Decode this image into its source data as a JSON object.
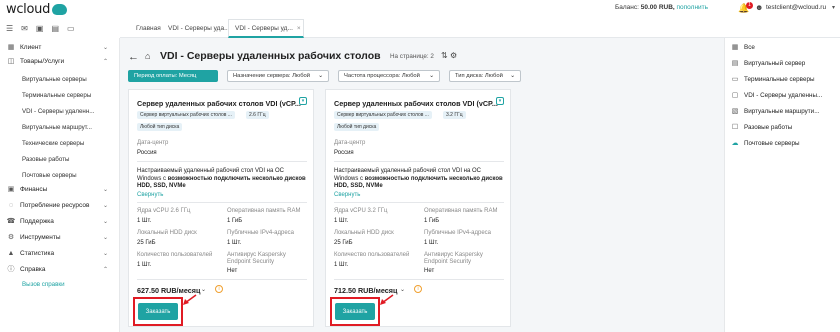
{
  "header": {
    "logo": "wcloud",
    "balance_label": "Баланс:",
    "balance_value": "50.00 RUB,",
    "topup": "пополнить",
    "user": "testclient@wcloud.ru",
    "notif_count": "1"
  },
  "breadcrumbs": [
    "Главная",
    "VDI - Серверы уда...",
    "VDI - Серверы уд..."
  ],
  "sidebar": {
    "items": [
      {
        "label": "Клиент"
      },
      {
        "label": "Товары/Услуги"
      },
      {
        "label": "Финансы"
      },
      {
        "label": "Потребление ресурсов"
      },
      {
        "label": "Поддержка"
      },
      {
        "label": "Инструменты"
      },
      {
        "label": "Статистика"
      },
      {
        "label": "Справка"
      }
    ],
    "products_sub": [
      "Виртуальные серверы",
      "Терминальные серверы",
      "VDI - Серверы удаленн...",
      "Виртуальные маршрут...",
      "Технические серверы",
      "Разовые работы",
      "Почтовые серверы"
    ],
    "help_sub": [
      "Вызов справки"
    ]
  },
  "page": {
    "title": "VDI - Серверы удаленных рабочих столов",
    "per_page": "На странице: 2"
  },
  "filters": [
    "Период оплаты: Месяц",
    "Назначение сервера: Любой",
    "Частота процессора: Любой",
    "Тип диска: Любой"
  ],
  "right_panel": [
    "Все",
    "Виртуальный сервер",
    "Терминальные серверы",
    "VDI - Серверы удаленны...",
    "Виртуальные маршрути...",
    "Разовые работы",
    "Почтовые серверы"
  ],
  "cards": [
    {
      "title": "Сервер удаленных рабочих столов VDI (vCP...",
      "tag1": "Сервер виртуальных рабочих столов ...",
      "tag2": "2.6 ГГц",
      "tag3": "Любой тип диска",
      "dc_label": "Дата-центр",
      "dc_value": "Россия",
      "desc_plain": "Настраиваемый удаленный рабочий стол VDI на ОС Windows с",
      "desc_bold": "возможностью подключить несколько дисков HDD, SSD, NVMe",
      "collapse": "Свернуть",
      "specs": [
        {
          "label": "Ядра vCPU 2.6 ГГц",
          "value": "1 Шт."
        },
        {
          "label": "Оперативная память RAM",
          "value": "1 ГиБ"
        },
        {
          "label": "Локальный HDD диск",
          "value": "25 ГиБ"
        },
        {
          "label": "Публичные IPv4-адреса",
          "value": "1 Шт."
        },
        {
          "label": "Количество пользователей",
          "value": "1 Шт."
        },
        {
          "label": "Антивирус Kaspersky Endpoint Security",
          "value": "Нет"
        }
      ],
      "price": "627.50 RUB/месяц",
      "order": "Заказать"
    },
    {
      "title": "Сервер удаленных рабочих столов VDI (vCP...",
      "tag1": "Сервер виртуальных рабочих столов ...",
      "tag2": "3.2 ГГц",
      "tag3": "Любой тип диска",
      "dc_label": "Дата-центр",
      "dc_value": "Россия",
      "desc_plain": "Настраиваемый удаленный рабочий стол VDI на ОС Windows с",
      "desc_bold": "возможностью подключить несколько дисков HDD, SSD, NVMe",
      "collapse": "Свернуть",
      "specs": [
        {
          "label": "Ядра vCPU 3.2 ГГц",
          "value": "1 Шт."
        },
        {
          "label": "Оперативная память RAM",
          "value": "1 ГиБ"
        },
        {
          "label": "Локальный HDD диск",
          "value": "25 ГиБ"
        },
        {
          "label": "Публичные IPv4-адреса",
          "value": "1 Шт."
        },
        {
          "label": "Количество пользователей",
          "value": "1 Шт."
        },
        {
          "label": "Антивирус Kaspersky Endpoint Security",
          "value": "Нет"
        }
      ],
      "price": "712.50 RUB/месяц",
      "order": "Заказать"
    }
  ],
  "colors": {
    "accent": "#1fa3a3",
    "highlight": "#e01b24"
  }
}
